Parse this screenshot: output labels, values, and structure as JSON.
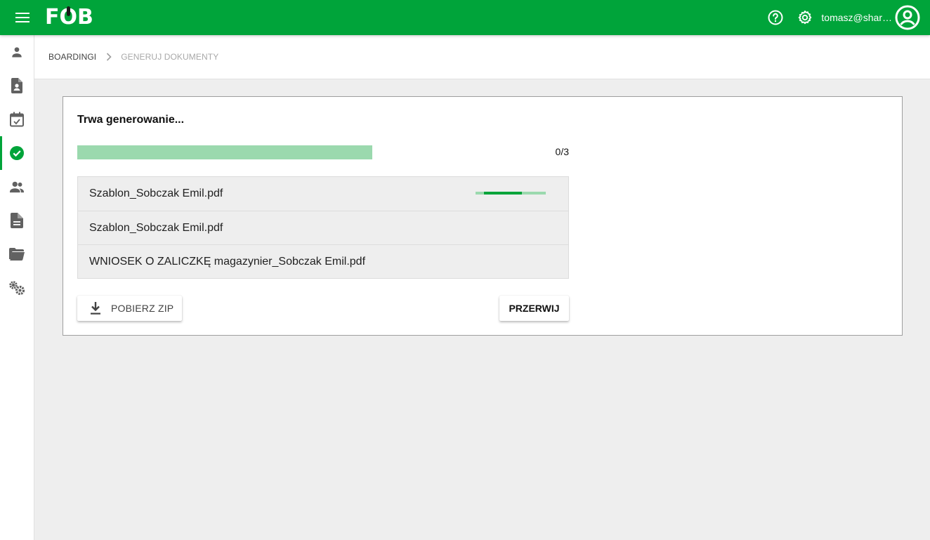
{
  "app": {
    "logo_text": "FOB",
    "user_email": "tomasz@shar…"
  },
  "colors": {
    "brand": "#00a43a",
    "progress_track": "#9bd9ae"
  },
  "icons": {
    "menu": "menu-icon",
    "help": "help-circle-icon",
    "settings": "gear-icon",
    "account": "account-circle-icon"
  },
  "sidebar": {
    "items": [
      {
        "icon": "person-icon",
        "active": false
      },
      {
        "icon": "contact-document-icon",
        "active": false
      },
      {
        "icon": "calendar-check-icon",
        "active": false
      },
      {
        "icon": "check-circle-icon",
        "active": true
      },
      {
        "icon": "people-icon",
        "active": false
      },
      {
        "icon": "document-icon",
        "active": false
      },
      {
        "icon": "folder-open-icon",
        "active": false
      },
      {
        "icon": "gears-icon",
        "active": false
      }
    ]
  },
  "breadcrumb": {
    "items": [
      "BOARDINGI",
      "GENERUJ DOKUMENTY"
    ]
  },
  "generation": {
    "title": "Trwa generowanie...",
    "progress": {
      "done": 0,
      "total": 3,
      "label": "0/3"
    },
    "files": [
      {
        "name": "Szablon_Sobczak Emil.pdf",
        "in_progress": true
      },
      {
        "name": "Szablon_Sobczak Emil.pdf",
        "in_progress": false
      },
      {
        "name": "WNIOSEK O ZALICZKĘ magazynier_Sobczak Emil.pdf",
        "in_progress": false
      }
    ],
    "download_label": "POBIERZ ZIP",
    "cancel_label": "PRZERWIJ"
  }
}
